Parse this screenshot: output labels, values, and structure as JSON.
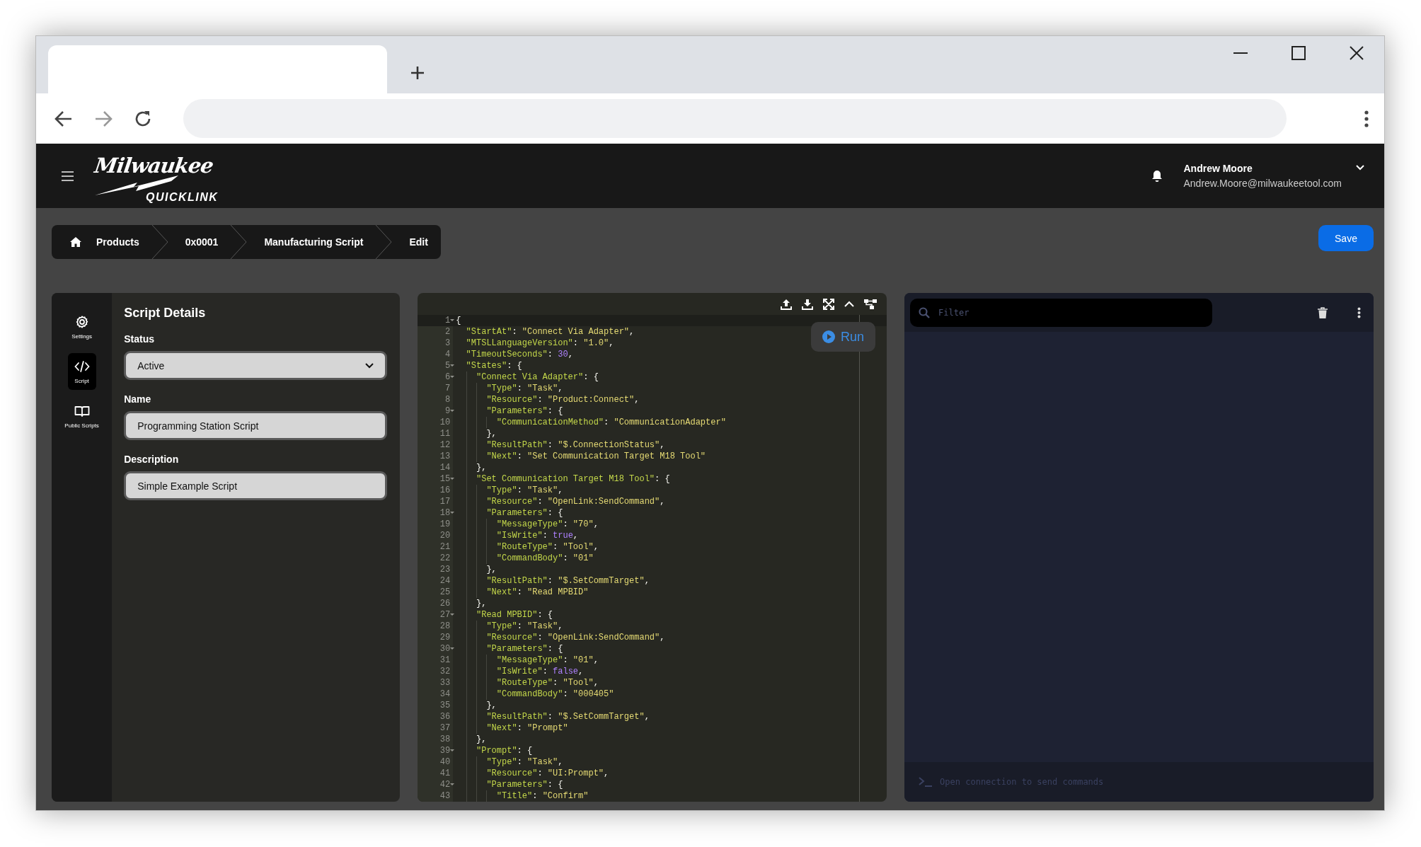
{
  "header": {
    "logo": {
      "brand": "Milwaukee",
      "product": "QUICKLINK"
    },
    "user": {
      "name": "Andrew Moore",
      "email": "Andrew.Moore@milwaukeetool.com"
    }
  },
  "breadcrumb": [
    {
      "label": "Products",
      "kind": "home"
    },
    {
      "label": "0x0001",
      "kind": "link"
    },
    {
      "label": "Manufacturing Script",
      "kind": "link"
    },
    {
      "label": "Edit",
      "kind": "link"
    }
  ],
  "save_button": "Save",
  "sidebar": {
    "items": [
      {
        "label": "Settings",
        "kind": "gear",
        "selected": false
      },
      {
        "label": "Script",
        "kind": "code",
        "selected": true
      },
      {
        "label": "Public Scripts",
        "kind": "book",
        "selected": false
      }
    ]
  },
  "details": {
    "title": "Script Details",
    "fields": [
      {
        "label": "Status",
        "kind": "select",
        "value": "Active"
      },
      {
        "label": "Name",
        "kind": "text",
        "value": "Programming Station Script"
      },
      {
        "label": "Description",
        "kind": "text",
        "value": "Simple Example Script"
      }
    ]
  },
  "editor": {
    "run_button": "Run",
    "lines": [
      {
        "number": "1",
        "text": "{",
        "current": true
      },
      {
        "number": "2",
        "text": "  \"StartAt\": \"Connect Via Adapter\",",
        "current": false
      },
      {
        "number": "3",
        "text": "  \"MTSLLanguageVersion\": \"1.0\",",
        "current": false
      },
      {
        "number": "4",
        "text": "  \"TimeoutSeconds\": 30,",
        "current": false
      },
      {
        "number": "5",
        "text": "  \"States\": {",
        "current": false
      },
      {
        "number": "6",
        "text": "    \"Connect Via Adapter\": {",
        "current": false
      },
      {
        "number": "7",
        "text": "      \"Type\": \"Task\",",
        "current": false
      },
      {
        "number": "8",
        "text": "      \"Resource\": \"Product:Connect\",",
        "current": false
      },
      {
        "number": "9",
        "text": "      \"Parameters\": {",
        "current": false
      },
      {
        "number": "10",
        "text": "        \"CommunicationMethod\": \"CommunicationAdapter\"",
        "current": false
      },
      {
        "number": "11",
        "text": "      },",
        "current": false
      },
      {
        "number": "12",
        "text": "      \"ResultPath\": \"$.ConnectionStatus\",",
        "current": false
      },
      {
        "number": "13",
        "text": "      \"Next\": \"Set Communication Target M18 Tool\"",
        "current": false
      },
      {
        "number": "14",
        "text": "    },",
        "current": false
      },
      {
        "number": "15",
        "text": "    \"Set Communication Target M18 Tool\": {",
        "current": false
      },
      {
        "number": "16",
        "text": "      \"Type\": \"Task\",",
        "current": false
      },
      {
        "number": "17",
        "text": "      \"Resource\": \"OpenLink:SendCommand\",",
        "current": false
      },
      {
        "number": "18",
        "text": "      \"Parameters\": {",
        "current": false
      },
      {
        "number": "19",
        "text": "        \"MessageType\": \"70\",",
        "current": false
      },
      {
        "number": "20",
        "text": "        \"IsWrite\": true,",
        "current": false
      },
      {
        "number": "21",
        "text": "        \"RouteType\": \"Tool\",",
        "current": false
      },
      {
        "number": "22",
        "text": "        \"CommandBody\": \"01\"",
        "current": false
      },
      {
        "number": "23",
        "text": "      },",
        "current": false
      },
      {
        "number": "24",
        "text": "      \"ResultPath\": \"$.SetCommTarget\",",
        "current": false
      },
      {
        "number": "25",
        "text": "      \"Next\": \"Read MPBID\"",
        "current": false
      },
      {
        "number": "26",
        "text": "    },",
        "current": false
      },
      {
        "number": "27",
        "text": "    \"Read MPBID\": {",
        "current": false
      },
      {
        "number": "28",
        "text": "      \"Type\": \"Task\",",
        "current": false
      },
      {
        "number": "29",
        "text": "      \"Resource\": \"OpenLink:SendCommand\",",
        "current": false
      },
      {
        "number": "30",
        "text": "      \"Parameters\": {",
        "current": false
      },
      {
        "number": "31",
        "text": "        \"MessageType\": \"01\",",
        "current": false
      },
      {
        "number": "32",
        "text": "        \"IsWrite\": false,",
        "current": false
      },
      {
        "number": "33",
        "text": "        \"RouteType\": \"Tool\",",
        "current": false
      },
      {
        "number": "34",
        "text": "        \"CommandBody\": \"000405\"",
        "current": false
      },
      {
        "number": "35",
        "text": "      },",
        "current": false
      },
      {
        "number": "36",
        "text": "      \"ResultPath\": \"$.SetCommTarget\",",
        "current": false
      },
      {
        "number": "37",
        "text": "      \"Next\": \"Prompt\"",
        "current": false
      },
      {
        "number": "38",
        "text": "    },",
        "current": false
      },
      {
        "number": "39",
        "text": "    \"Prompt\": {",
        "current": false
      },
      {
        "number": "40",
        "text": "      \"Type\": \"Task\",",
        "current": false
      },
      {
        "number": "41",
        "text": "      \"Resource\": \"UI:Prompt\",",
        "current": false
      },
      {
        "number": "42",
        "text": "      \"Parameters\": {",
        "current": false
      },
      {
        "number": "43",
        "text": "        \"Title\": \"Confirm\"",
        "current": false
      }
    ]
  },
  "console": {
    "filter": {
      "placeholder": "Filter"
    },
    "command": {
      "placeholder": "Open connection to send commands"
    }
  }
}
